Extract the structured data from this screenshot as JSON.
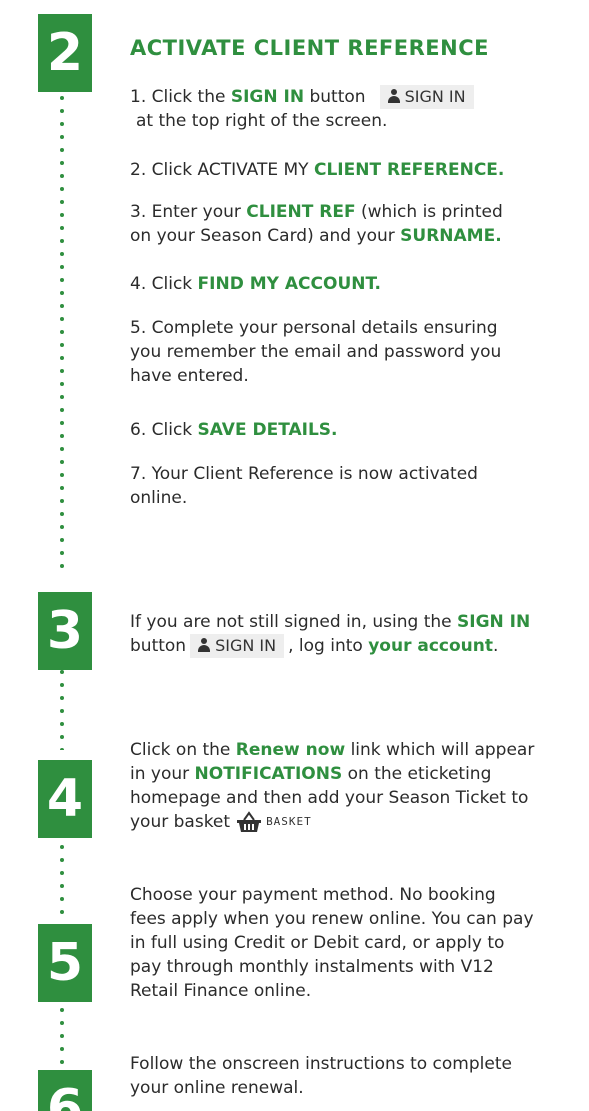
{
  "colors": {
    "accent": "#2f8f3f",
    "text": "#2b2b2b"
  },
  "steps": {
    "step2": {
      "number": "2",
      "title": "ACTIVATE CLIENT REFERENCE"
    },
    "step3": {
      "number": "3"
    },
    "step4": {
      "number": "4"
    },
    "step5": {
      "number": "5"
    },
    "step6": {
      "number": "6"
    }
  },
  "s2": {
    "i1": {
      "a": "1. Click the ",
      "b": "SIGN IN",
      "c": " button",
      "d": "at the top right of the screen."
    },
    "i2": {
      "a": "2. Click ACTIVATE MY ",
      "b": "CLIENT REFERENCE."
    },
    "i3": {
      "a": "3. Enter your ",
      "b": "CLIENT REF",
      "c": " (which is printed",
      "d": "on your Season Card) and your ",
      "e": "SURNAME."
    },
    "i4": {
      "a": "4. Click ",
      "b": "FIND MY ACCOUNT."
    },
    "i5": {
      "a": "5. Complete your personal details ensuring",
      "b": "you remember the email and password you",
      "c": "have entered."
    },
    "i6": {
      "a": "6. Click ",
      "b": "SAVE DETAILS."
    },
    "i7": {
      "a": "7. Your Client Reference is now activated",
      "b": "online."
    }
  },
  "signin_button": {
    "label": "SIGN IN",
    "icon": "person-icon"
  },
  "s3": {
    "a": "If you are not still signed in, using the ",
    "b": "SIGN IN",
    "c": "button",
    "d": ", log into ",
    "e": "your account",
    "f": "."
  },
  "s4": {
    "a": "Click on the ",
    "b": "Renew now",
    "c": " link which will appear",
    "d": "in your ",
    "e": "NOTIFICATIONS",
    "f": " on the eticketing",
    "g": "homepage and then add your Season Ticket to",
    "h": "your basket"
  },
  "basket_button": {
    "label": "BASKET",
    "icon": "basket-icon"
  },
  "s5": {
    "a": "Choose your payment method. No booking",
    "b": "fees apply when you renew online. You can pay",
    "c": "in full using Credit or Debit card, or apply to",
    "d": "pay through monthly instalments with V12",
    "e": "Retail Finance online."
  },
  "s6": {
    "a": "Follow the onscreen instructions to complete",
    "b": "your online renewal."
  }
}
